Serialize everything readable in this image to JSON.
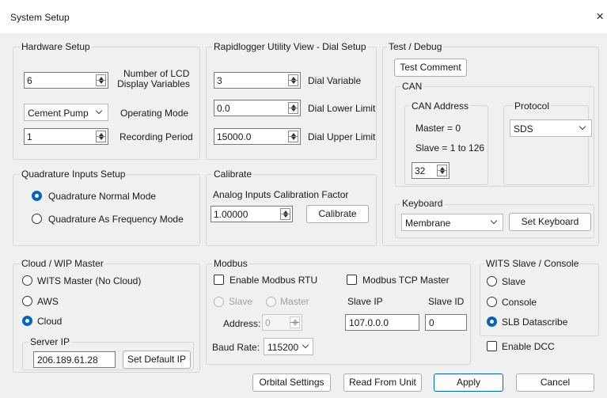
{
  "window": {
    "title": "System Setup",
    "close_glyph": "×"
  },
  "hardware": {
    "group_label": "Hardware Setup",
    "lcd_vars_value": "6",
    "lcd_vars_label_line1": "Number of LCD",
    "lcd_vars_label_line2": "Display Variables",
    "operating_mode_value": "Cement Pump",
    "operating_mode_label": "Operating Mode",
    "recording_period_value": "1",
    "recording_period_label": "Recording Period"
  },
  "dial": {
    "group_label": "Rapidlogger Utility View - Dial Setup",
    "dial_variable_value": "3",
    "dial_variable_label": "Dial Variable",
    "dial_lower_value": "0.0",
    "dial_lower_label": "Dial Lower Limit",
    "dial_upper_value": "15000.0",
    "dial_upper_label": "Dial Upper Limit"
  },
  "test_debug": {
    "group_label": "Test / Debug",
    "test_comment_button": "Test Comment",
    "can": {
      "group_label": "CAN",
      "address_group_label": "CAN Address",
      "master_text": "Master = 0",
      "slave_text": "Slave = 1 to 126",
      "address_value": "32",
      "protocol_group_label": "Protocol",
      "protocol_value": "SDS"
    },
    "keyboard": {
      "group_label": "Keyboard",
      "value": "Membrane",
      "set_button": "Set Keyboard"
    }
  },
  "quadrature": {
    "group_label": "Quadrature Inputs Setup",
    "normal_mode_label": "Quadrature Normal Mode",
    "frequency_mode_label": "Quadrature As Frequency Mode",
    "selected": "normal"
  },
  "calibrate": {
    "group_label": "Calibrate",
    "factor_label": "Analog Inputs Calibration Factor",
    "factor_value": "1.00000",
    "button": "Calibrate"
  },
  "cloud": {
    "group_label": "Cloud / WIP Master",
    "options": [
      "WITS Master (No Cloud)",
      "AWS",
      "Cloud"
    ],
    "selected_index": 2,
    "server_ip_group_label": "Server IP",
    "server_ip_value": "206.189.61.28",
    "set_default_ip_button": "Set Default IP"
  },
  "modbus": {
    "group_label": "Modbus",
    "enable_rtu_label": "Enable Modbus RTU",
    "tcp_master_label": "Modbus TCP Master",
    "slave_radio_label": "Slave",
    "master_radio_label": "Master",
    "address_label": "Address:",
    "address_value": "0",
    "baud_rate_label": "Baud Rate:",
    "baud_rate_value": "115200",
    "slave_ip_label": "Slave IP",
    "slave_ip_value": "107.0.0.0",
    "slave_id_label": "Slave ID",
    "slave_id_value": "0"
  },
  "wits": {
    "group_label": "WITS Slave / Console",
    "options": [
      "Slave",
      "Console",
      "SLB Datascribe"
    ],
    "selected_index": 2,
    "enable_dcc_label": "Enable DCC"
  },
  "footer": {
    "orbital_settings": "Orbital Settings",
    "read_from_unit": "Read From Unit",
    "apply": "Apply",
    "cancel": "Cancel"
  },
  "colors": {
    "accent": "#0067c0",
    "dialog_bg": "#f0f0f0",
    "border": "#d5d5d5"
  },
  "icons": {
    "close": "close-icon",
    "spin": "spin-arrows-icon",
    "dropdown": "chevron-down-icon"
  }
}
